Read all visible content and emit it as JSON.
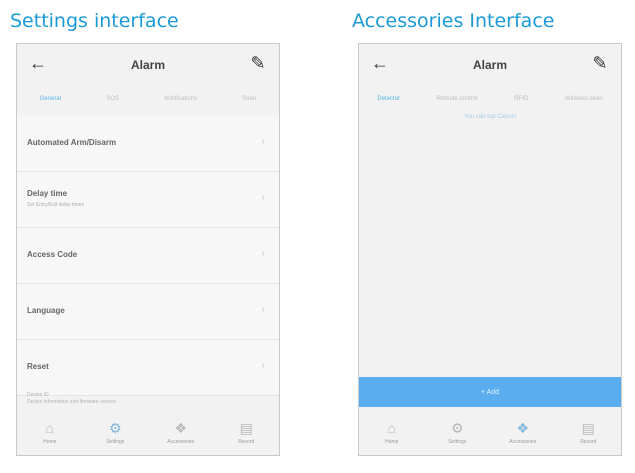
{
  "sections": {
    "settings_title": "Settings interface",
    "accessories_title": "Accessories Interface"
  },
  "settings_screen": {
    "title": "Alarm",
    "tabs": [
      "General",
      "SOS",
      "Notifications",
      "Siren"
    ],
    "items": [
      {
        "label": "Automated Arm/Disarm",
        "sub": ""
      },
      {
        "label": "Delay time",
        "sub": "Set Entry/Exit delay times"
      },
      {
        "label": "Access Code",
        "sub": ""
      },
      {
        "label": "Language",
        "sub": ""
      },
      {
        "label": "Reset",
        "sub": ""
      }
    ],
    "footer_lines": [
      "Device ID",
      "Device information and firmware version"
    ],
    "nav": [
      "Home",
      "Settings",
      "Accessories",
      "Record"
    ]
  },
  "accessories_screen": {
    "title": "Alarm",
    "tabs": [
      "Detector",
      "Remote control",
      "RFID",
      "Wireless siren"
    ],
    "hint": "You can tap Cancel",
    "add_label": "+ Add",
    "nav": [
      "Home",
      "Settings",
      "Accessories",
      "Record"
    ]
  }
}
